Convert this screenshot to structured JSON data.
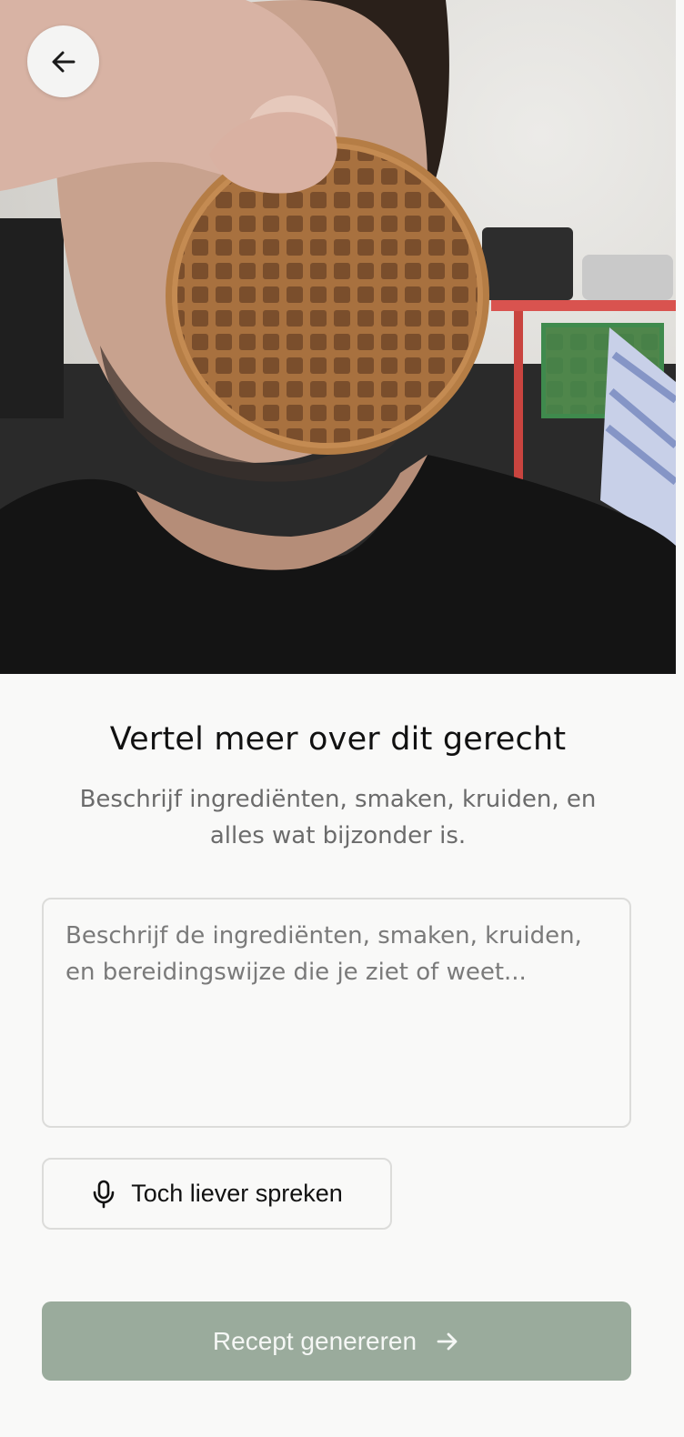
{
  "header": {
    "back_icon": "arrow-left-icon"
  },
  "photo": {
    "subject": "person holding a stroopwafel in front of face"
  },
  "main": {
    "title": "Vertel meer over dit gerecht",
    "subtitle": "Beschrijf ingrediënten, smaken, kruiden, en alles wat bijzonder is.",
    "description_input": {
      "value": "",
      "placeholder": "Beschrijf de ingrediënten, smaken, kruiden, en bereidingswijze die je ziet of weet..."
    },
    "speak_button": {
      "label": "Toch liever spreken",
      "icon": "microphone-icon"
    },
    "generate_button": {
      "label": "Recept genereren",
      "icon": "arrow-right-icon"
    }
  },
  "colors": {
    "background": "#f9f9f8",
    "primary_button": "#9aab9c",
    "border": "#dcdcda",
    "title_text": "#111111",
    "muted_text": "#6b6b6b"
  }
}
